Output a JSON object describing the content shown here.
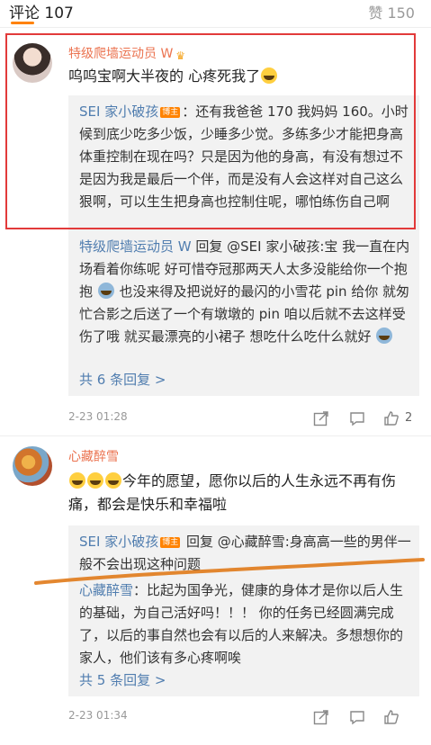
{
  "header": {
    "comments_label": "评论 107",
    "likes_label": "赞 150"
  },
  "comment1": {
    "username": "特级爬墙运动员 W",
    "text": "呜呜宝啊大半夜的 心疼死我了",
    "replies": [
      {
        "name": "SEI 家小破孩",
        "tag": "博主",
        "text": "：还有我爸爸 170 我妈妈 160。小时候到底少吃多少饭，少睡多少觉。多练多少才能把身高体重控制在现在吗？只是因为他的身高，有没有想过不是因为我是最后一个伴，而是没有人会这样对自己这么狠啊，可以生生把身高也控制住呢，哪怕练伤自己啊"
      },
      {
        "name": "特级爬墙运动员 W",
        "text": " 回复 @SEI 家小破孩:宝 我一直在内场看着你练呢 好可惜夺冠那两天人太多没能给你一个抱抱 ",
        "text2": " 也没来得及把说好的最闪的小雪花 pin 给你 就匆忙合影之后送了一个有墩墩的 pin 咱以后就不去这样受伤了哦 就买最漂亮的小裙子 想吃什么吃什么就好 "
      }
    ],
    "more_replies": "共 6 条回复 >",
    "timestamp": "2-23 01:28",
    "like_count": "2"
  },
  "comment2": {
    "username": "心藏醉雪",
    "text": "今年的愿望，愿你以后的人生永远不再有伤痛，都会是快乐和幸福啦",
    "replies": [
      {
        "name": "SEI 家小破孩",
        "tag": "博主",
        "text": " 回复 @心藏醉雪:身高高一些的男伴一般不会出现这种问题"
      },
      {
        "name": "心藏醉雪",
        "text": "：比起为国争光，健康的身体才是你以后人生的基础，为自己活好吗！！！ 你的任务已经圆满完成了，以后的事自然也会有以后的人来解决。多想想你的家人，他们该有多心疼啊唉"
      }
    ],
    "more_replies": "共 5 条回复 >",
    "timestamp": "2-23 01:34"
  },
  "icons": [
    "share-icon",
    "comment-icon",
    "like-icon"
  ],
  "colors": {
    "accent_orange": "#ff8200",
    "username_orange": "#eb7350",
    "link_blue": "#507daf",
    "highlight_red": "#e23a3a"
  }
}
